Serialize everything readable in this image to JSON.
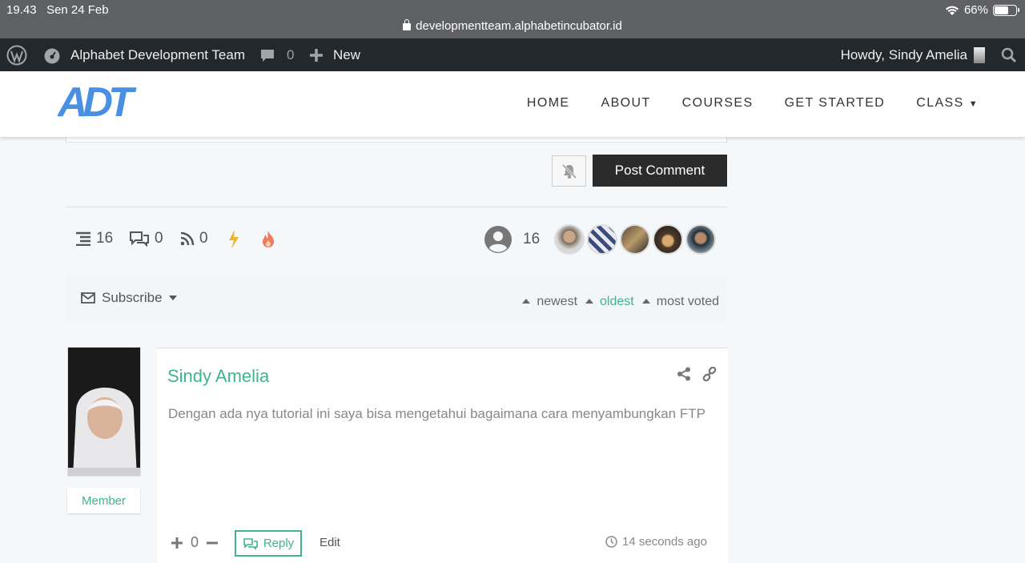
{
  "status": {
    "time": "19.43",
    "date": "Sen 24 Feb",
    "battery": "66%",
    "battery_level": 0.66
  },
  "browser": {
    "url": "developmentteam.alphabetincubator.id"
  },
  "adminbar": {
    "site_name": "Alphabet Development Team",
    "comments_count": "0",
    "new_label": "New",
    "howdy": "Howdy, Sindy Amelia"
  },
  "site": {
    "logo_text": "ADT"
  },
  "nav": {
    "items": [
      "HOME",
      "ABOUT",
      "COURSES",
      "GET STARTED",
      "CLASS"
    ]
  },
  "form": {
    "post_label": "Post Comment"
  },
  "stats": {
    "threads": "16",
    "replies": "0",
    "feeds": "0",
    "participants": "16"
  },
  "subscribe": {
    "label": "Subscribe"
  },
  "sort": {
    "newest": "newest",
    "oldest": "oldest",
    "most_voted": "most voted",
    "active": "oldest"
  },
  "comment": {
    "author": "Sindy Amelia",
    "role": "Member",
    "text": "Dengan ada nya tutorial ini saya bisa mengetahui bagaimana cara menyambungkan FTP",
    "votes": "0",
    "reply_label": "Reply",
    "edit_label": "Edit",
    "time_ago": "14 seconds ago"
  },
  "colors": {
    "accent": "#3fb58a",
    "adminbar": "#23282d",
    "logo_blue": "#4a90e2"
  }
}
